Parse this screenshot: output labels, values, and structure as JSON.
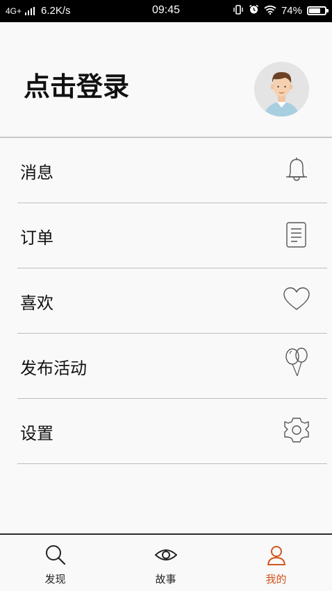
{
  "status_bar": {
    "network": "4G+",
    "speed": "6.2K/s",
    "time": "09:45",
    "battery": "74%",
    "battery_level": 0.74
  },
  "header": {
    "login_text": "点击登录",
    "avatar": "user-avatar"
  },
  "menu": {
    "items": [
      {
        "label": "消息",
        "icon": "bell-icon"
      },
      {
        "label": "订单",
        "icon": "document-icon"
      },
      {
        "label": "喜欢",
        "icon": "heart-icon"
      },
      {
        "label": "发布活动",
        "icon": "balloons-icon"
      },
      {
        "label": "设置",
        "icon": "gear-icon"
      }
    ]
  },
  "tabs": {
    "items": [
      {
        "label": "发现",
        "icon": "search-icon"
      },
      {
        "label": "故事",
        "icon": "eye-icon"
      },
      {
        "label": "我的",
        "icon": "person-icon",
        "active": true
      }
    ]
  },
  "colors": {
    "accent": "#d2551e",
    "divider": "#bdbdbd",
    "background": "#f9f9f9",
    "status_bar": "#000000"
  }
}
